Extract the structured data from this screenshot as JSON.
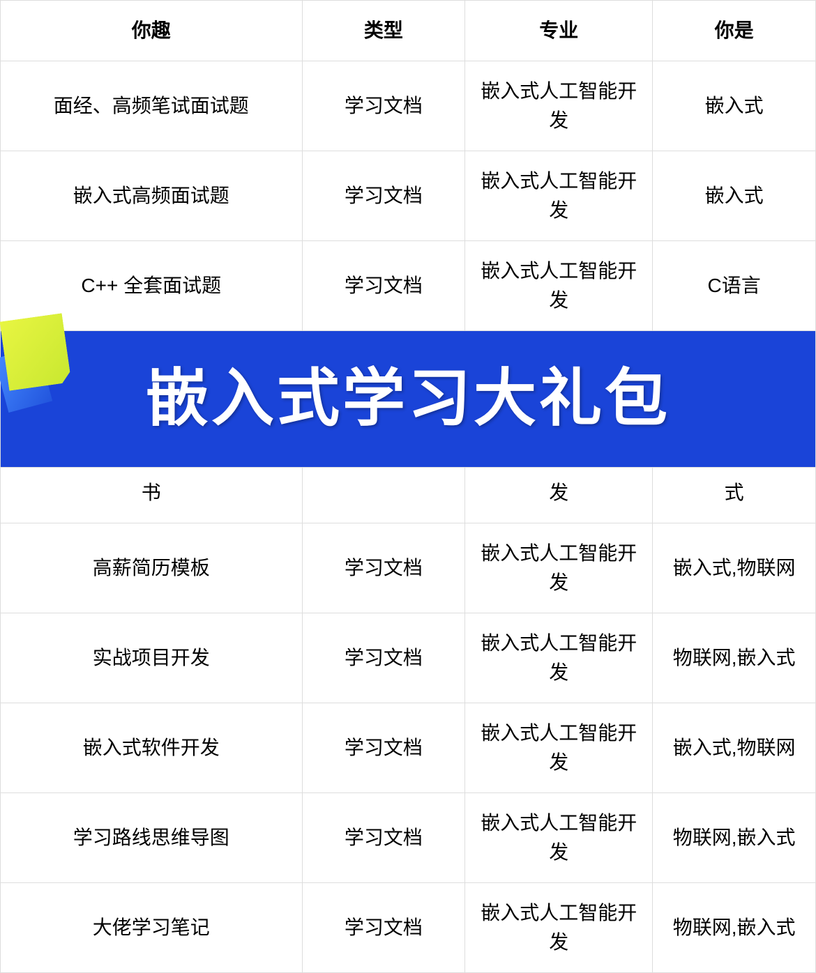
{
  "table": {
    "headers": [
      "你趣",
      "类型",
      "专业",
      "你是"
    ],
    "rows": [
      {
        "id": "row-1",
        "col1": "面经、高频笔试面试题",
        "col2": "学习文档",
        "col3": "嵌入式人工智能开发",
        "col4": "嵌入式"
      },
      {
        "id": "row-2",
        "col1": "嵌入式高频面试题",
        "col2": "学习文档",
        "col3": "嵌入式人工智能开发",
        "col4": "嵌入式"
      },
      {
        "id": "row-3",
        "col1": "C++ 全套面试题",
        "col2": "学习文档",
        "col3": "嵌入式人工智能开发",
        "col4": "C语言"
      },
      {
        "id": "row-partial",
        "col1": "书",
        "col2": "",
        "col3": "发",
        "col4": "式"
      },
      {
        "id": "row-4",
        "col1": "高薪简历模板",
        "col2": "学习文档",
        "col3": "嵌入式人工智能开发",
        "col4": "嵌入式,物联网"
      },
      {
        "id": "row-5",
        "col1": "实战项目开发",
        "col2": "学习文档",
        "col3": "嵌入式人工智能开发",
        "col4": "物联网,嵌入式"
      },
      {
        "id": "row-6",
        "col1": "嵌入式软件开发",
        "col2": "学习文档",
        "col3": "嵌入式人工智能开发",
        "col4": "嵌入式,物联网"
      },
      {
        "id": "row-7",
        "col1": "学习路线思维导图",
        "col2": "学习文档",
        "col3": "嵌入式人工智能开发",
        "col4": "物联网,嵌入式"
      },
      {
        "id": "row-8",
        "col1": "大佬学习笔记",
        "col2": "学习文档",
        "col3": "嵌入式人工智能开发",
        "col4": "物联网,嵌入式"
      }
    ],
    "banner": {
      "text": "嵌入式学习大礼包",
      "bg_color": "#1a44d8",
      "text_color": "#ffffff"
    }
  }
}
